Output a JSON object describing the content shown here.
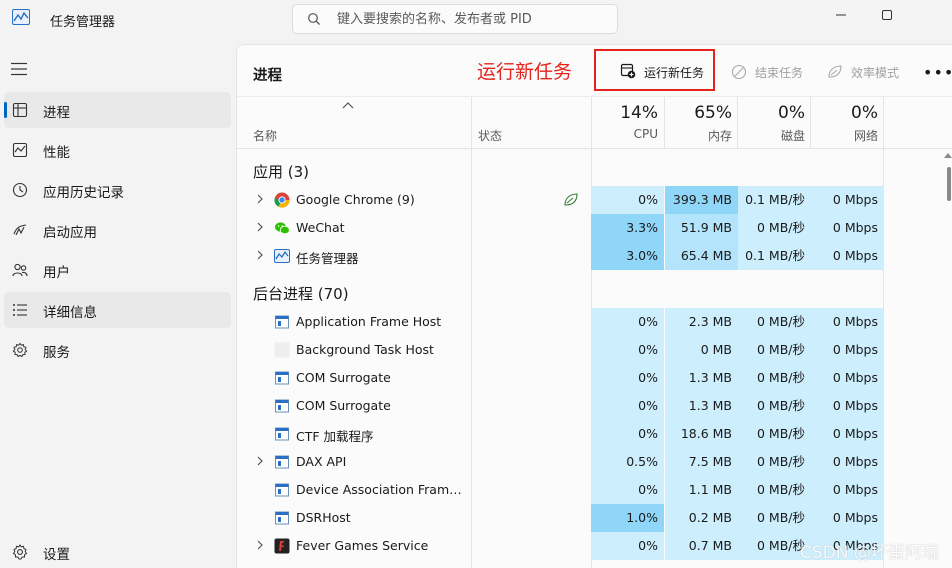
{
  "window": {
    "title": "任务管理器",
    "search_placeholder": "键入要搜索的名称、发布者或 PID"
  },
  "sidebar": {
    "items": [
      {
        "label": "进程",
        "icon": "processes-icon",
        "active": true
      },
      {
        "label": "性能",
        "icon": "performance-icon",
        "active": false
      },
      {
        "label": "应用历史记录",
        "icon": "app-history-icon",
        "active": false
      },
      {
        "label": "启动应用",
        "icon": "startup-icon",
        "active": false
      },
      {
        "label": "用户",
        "icon": "users-icon",
        "active": false
      },
      {
        "label": "详细信息",
        "icon": "details-icon",
        "active": false
      },
      {
        "label": "服务",
        "icon": "services-icon",
        "active": false
      }
    ],
    "settings_label": "设置"
  },
  "toolbar": {
    "page_title": "进程",
    "annotation": "运行新任务",
    "run_task_label": "运行新任务",
    "end_task_label": "结束任务",
    "efficiency_label": "效率模式",
    "more_label": "•••"
  },
  "table": {
    "columns": {
      "name": "名称",
      "status": "状态",
      "cpu": {
        "pct": "14%",
        "label": "CPU"
      },
      "memory": {
        "pct": "65%",
        "label": "内存"
      },
      "disk": {
        "pct": "0%",
        "label": "磁盘"
      },
      "network": {
        "pct": "0%",
        "label": "网络"
      }
    },
    "apps_section": "应用 (3)",
    "background_section": "后台进程 (70)",
    "apps": [
      {
        "name": "Google Chrome (9)",
        "cpu": "0%",
        "memory": "399.3 MB",
        "disk": "0.1 MB/秒",
        "network": "0 Mbps",
        "expandable": true,
        "icon": "chrome-icon",
        "efficiency": true
      },
      {
        "name": "WeChat",
        "cpu": "3.3%",
        "memory": "51.9 MB",
        "disk": "0 MB/秒",
        "network": "0 Mbps",
        "expandable": true,
        "icon": "wechat-icon"
      },
      {
        "name": "任务管理器",
        "cpu": "3.0%",
        "memory": "65.4 MB",
        "disk": "0.1 MB/秒",
        "network": "0 Mbps",
        "expandable": true,
        "icon": "task-manager-icon"
      }
    ],
    "background": [
      {
        "name": "Application Frame Host",
        "cpu": "0%",
        "memory": "2.3 MB",
        "disk": "0 MB/秒",
        "network": "0 Mbps",
        "expandable": false,
        "icon": "window-app-icon"
      },
      {
        "name": "Background Task Host",
        "cpu": "0%",
        "memory": "0 MB",
        "disk": "0 MB/秒",
        "network": "0 Mbps",
        "expandable": false,
        "icon": "blank-app-icon"
      },
      {
        "name": "COM Surrogate",
        "cpu": "0%",
        "memory": "1.3 MB",
        "disk": "0 MB/秒",
        "network": "0 Mbps",
        "expandable": false,
        "icon": "window-app-icon"
      },
      {
        "name": "COM Surrogate",
        "cpu": "0%",
        "memory": "1.3 MB",
        "disk": "0 MB/秒",
        "network": "0 Mbps",
        "expandable": false,
        "icon": "window-app-icon"
      },
      {
        "name": "CTF 加载程序",
        "cpu": "0%",
        "memory": "18.6 MB",
        "disk": "0 MB/秒",
        "network": "0 Mbps",
        "expandable": false,
        "icon": "window-app-icon"
      },
      {
        "name": "DAX API",
        "cpu": "0.5%",
        "memory": "7.5 MB",
        "disk": "0 MB/秒",
        "network": "0 Mbps",
        "expandable": true,
        "icon": "window-app-icon"
      },
      {
        "name": "Device Association Framew...",
        "cpu": "0%",
        "memory": "1.1 MB",
        "disk": "0 MB/秒",
        "network": "0 Mbps",
        "expandable": false,
        "icon": "window-app-icon"
      },
      {
        "name": "DSRHost",
        "cpu": "1.0%",
        "memory": "0.2 MB",
        "disk": "0 MB/秒",
        "network": "0 Mbps",
        "expandable": false,
        "icon": "window-app-icon"
      },
      {
        "name": "Fever Games Service",
        "cpu": "0%",
        "memory": "0.7 MB",
        "disk": "0 MB/秒",
        "network": "0 Mbps",
        "expandable": true,
        "icon": "fever-games-icon"
      }
    ]
  },
  "watermark": "CSDN @坏蛋阿瑞"
}
